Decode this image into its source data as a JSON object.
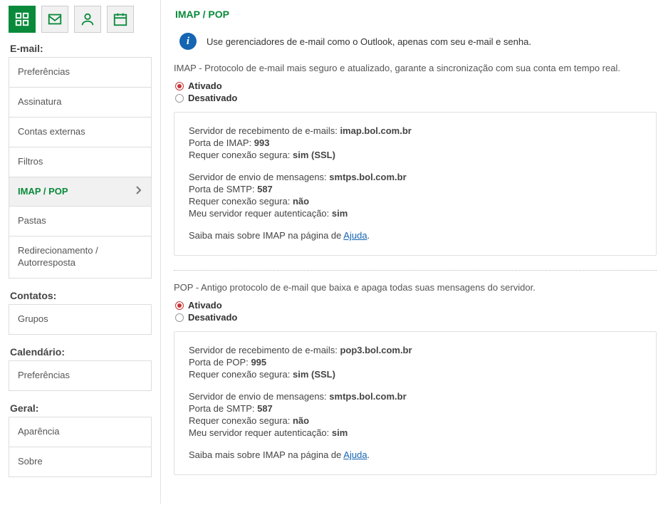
{
  "sidebar": {
    "sections": {
      "email": {
        "title": "E-mail:",
        "items": [
          {
            "label": "Preferências"
          },
          {
            "label": "Assinatura"
          },
          {
            "label": "Contas externas"
          },
          {
            "label": "Filtros"
          },
          {
            "label": "IMAP / POP"
          },
          {
            "label": "Pastas"
          },
          {
            "label": "Redirecionamento / Autorresposta"
          }
        ]
      },
      "contatos": {
        "title": "Contatos:",
        "items": [
          {
            "label": "Grupos"
          }
        ]
      },
      "calendario": {
        "title": "Calendário:",
        "items": [
          {
            "label": "Preferências"
          }
        ]
      },
      "geral": {
        "title": "Geral:",
        "items": [
          {
            "label": "Aparência"
          },
          {
            "label": "Sobre"
          }
        ]
      }
    }
  },
  "content": {
    "title": "IMAP / POP",
    "info_text": "Use gerenciadores de e-mail como o Outlook, apenas com seu e-mail e senha.",
    "imap": {
      "desc": "IMAP - Protocolo de e-mail mais seguro e atualizado, garante a sincronização com sua conta em tempo real.",
      "radio_on": "Ativado",
      "radio_off": "Desativado",
      "recv_label": "Servidor de recebimento de e-mails: ",
      "recv_value": "imap.bol.com.br",
      "port_label": "Porta de IMAP: ",
      "port_value": "993",
      "ssl_label": "Requer conexão segura: ",
      "ssl_value": "sim (SSL)",
      "send_label": "Servidor de envio de mensagens: ",
      "send_value": "smtps.bol.com.br",
      "smtp_port_label": "Porta de SMTP: ",
      "smtp_port_value": "587",
      "send_ssl_label": "Requer conexão segura: ",
      "send_ssl_value": "não",
      "auth_label": "Meu servidor requer autenticação: ",
      "auth_value": "sim",
      "help_prefix": "Saiba mais sobre IMAP na página de ",
      "help_link": "Ajuda",
      "help_suffix": "."
    },
    "pop": {
      "desc": "POP - Antigo protocolo de e-mail que baixa e apaga todas suas mensagens do servidor.",
      "radio_on": "Ativado",
      "radio_off": "Desativado",
      "recv_label": "Servidor de recebimento de e-mails: ",
      "recv_value": "pop3.bol.com.br",
      "port_label": "Porta de POP: ",
      "port_value": "995",
      "ssl_label": "Requer conexão segura: ",
      "ssl_value": "sim (SSL)",
      "send_label": "Servidor de envio de mensagens: ",
      "send_value": "smtps.bol.com.br",
      "smtp_port_label": "Porta de SMTP: ",
      "smtp_port_value": "587",
      "send_ssl_label": "Requer conexão segura: ",
      "send_ssl_value": "não",
      "auth_label": "Meu servidor requer autenticação: ",
      "auth_value": "sim",
      "help_prefix": "Saiba mais sobre IMAP na página de ",
      "help_link": "Ajuda",
      "help_suffix": "."
    }
  }
}
